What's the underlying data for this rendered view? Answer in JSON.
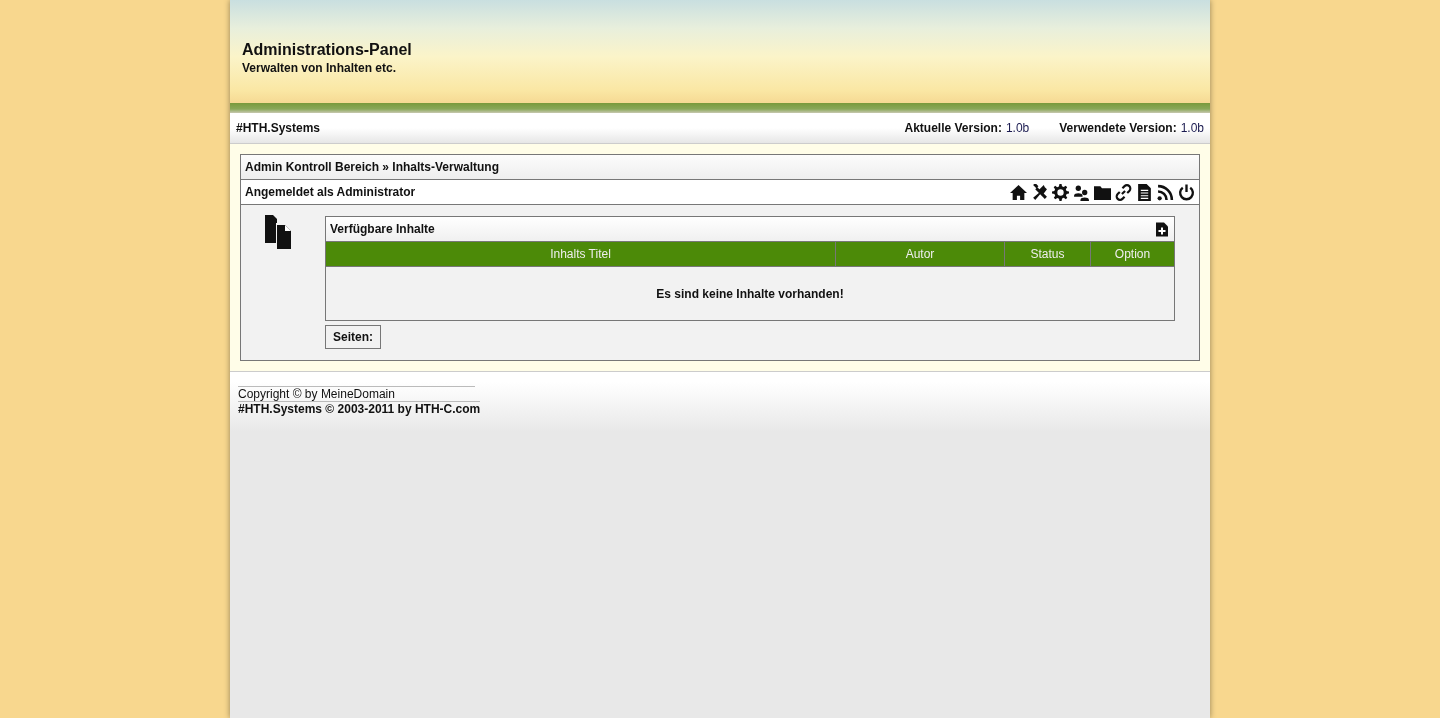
{
  "header": {
    "title": "Administrations-Panel",
    "subtitle": "Verwalten von Inhalten etc."
  },
  "top_bar": {
    "brand": "#HTH.Systems",
    "versions": [
      {
        "label": "Aktuelle Version:",
        "value": "1.0b"
      },
      {
        "label": "Verwendete Version:",
        "value": "1.0b"
      }
    ]
  },
  "breadcrumb": "Admin Kontroll Bereich » Inhalts-Verwaltung",
  "user_bar": {
    "text": "Angemeldet als Administrator",
    "toolbar": [
      {
        "kind": "home"
      },
      {
        "kind": "tools"
      },
      {
        "kind": "settings"
      },
      {
        "kind": "users"
      },
      {
        "kind": "folder"
      },
      {
        "kind": "link"
      },
      {
        "kind": "document"
      },
      {
        "kind": "rss"
      },
      {
        "kind": "power"
      }
    ]
  },
  "panel": {
    "title": "Verfügbare Inhalte",
    "columns": [
      "Inhalts Titel",
      "Autor",
      "Status",
      "Option"
    ],
    "empty_message": "Es sind keine Inhalte vorhanden!",
    "pages_label": "Seiten:"
  },
  "footer": {
    "copyright": "Copyright © by MeineDomain",
    "credit": "#HTH.Systems © 2003-2011 by HTH-C.com"
  }
}
